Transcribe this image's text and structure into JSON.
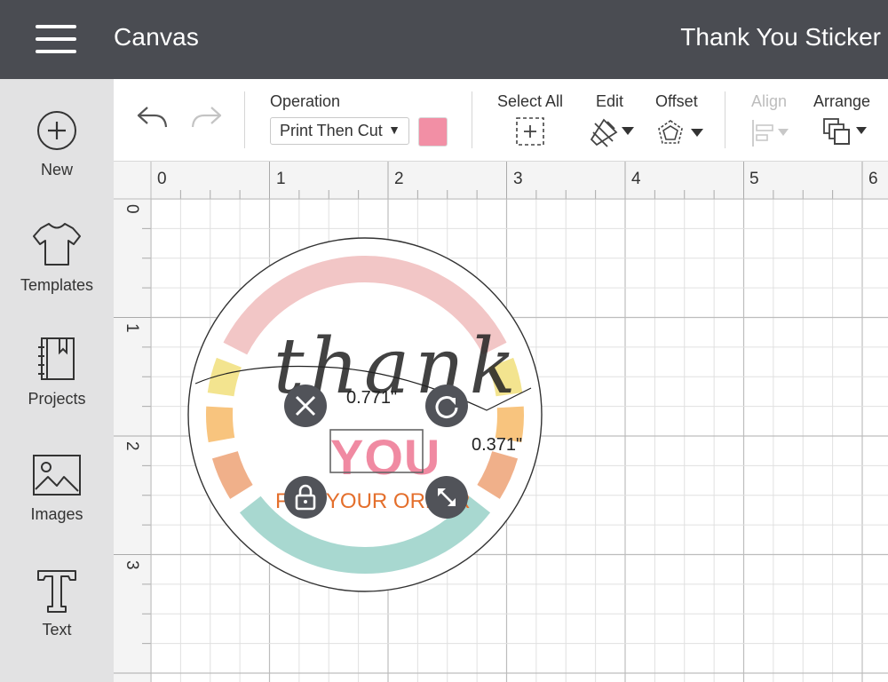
{
  "header": {
    "app_title": "Canvas",
    "project_title": "Thank You Sticker",
    "menu_icon": "hamburger-menu-icon",
    "background": "#4a4c52"
  },
  "sidebar": {
    "items": [
      {
        "label": "New",
        "icon": "plus-circle-icon"
      },
      {
        "label": "Templates",
        "icon": "tshirt-icon"
      },
      {
        "label": "Projects",
        "icon": "notebook-icon"
      },
      {
        "label": "Images",
        "icon": "image-icon"
      },
      {
        "label": "Text",
        "icon": "text-t-icon"
      }
    ]
  },
  "toolbar": {
    "undo_icon": "undo-arrow-icon",
    "redo_icon": "redo-arrow-icon",
    "operation": {
      "label": "Operation",
      "value": "Print Then Cut",
      "swatch_color": "#f28fa5"
    },
    "select_all": {
      "label": "Select All",
      "icon": "select-all-icon"
    },
    "edit": {
      "label": "Edit",
      "icon": "pencil-ruler-icon"
    },
    "offset": {
      "label": "Offset",
      "icon": "offset-icon"
    },
    "align": {
      "label": "Align",
      "icon": "align-icon",
      "enabled": false
    },
    "arrange": {
      "label": "Arrange",
      "icon": "arrange-icon"
    }
  },
  "ruler": {
    "horizontal": [
      "0",
      "1",
      "2",
      "3",
      "4",
      "5",
      "6"
    ],
    "vertical": [
      "0",
      "1",
      "2",
      "3"
    ]
  },
  "design": {
    "script_text": "thank",
    "main_text": "YOU",
    "sub_text": "FOR YOUR ORDER",
    "ring_colors": [
      "#f2c6c6",
      "#f3e48f",
      "#f8c47e",
      "#f0b08a",
      "#a8d8d0"
    ],
    "main_text_color": "#f08aa2",
    "sub_text_color": "#e46f2c"
  },
  "selection": {
    "width_label": "0.771\"",
    "height_label": "0.371\"",
    "handles": [
      "close-icon",
      "rotate-icon",
      "lock-icon",
      "resize-icon"
    ]
  }
}
